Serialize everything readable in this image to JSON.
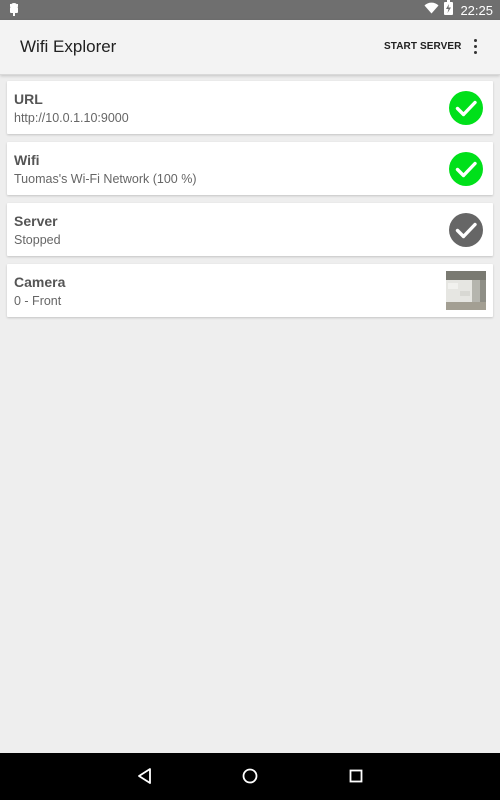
{
  "status_bar": {
    "time": "22:25",
    "icons": [
      "android-debug-icon",
      "wifi-icon",
      "battery-charging-icon"
    ]
  },
  "app_bar": {
    "title": "Wifi Explorer",
    "start_server_label": "START SERVER",
    "menu_icon": "overflow-menu-icon"
  },
  "cards": [
    {
      "title": "URL",
      "subtitle": "http://10.0.1.10:9000",
      "status": "ok",
      "status_color": "#00e01a"
    },
    {
      "title": "Wifi",
      "subtitle": "Tuomas's Wi-Fi Network (100 %)",
      "status": "ok",
      "status_color": "#00e01a"
    },
    {
      "title": "Server",
      "subtitle": "Stopped",
      "status": "inactive",
      "status_color": "#666666"
    },
    {
      "title": "Camera",
      "subtitle": "0 -  Front",
      "status": "camera-preview"
    }
  ],
  "nav_bar": {
    "buttons": [
      "back-icon",
      "home-icon",
      "recents-icon"
    ]
  },
  "colors": {
    "status_bar": "#6f6f6f",
    "app_bar": "#f3f3f3",
    "background": "#eeeeee",
    "nav_bar": "#000000"
  }
}
